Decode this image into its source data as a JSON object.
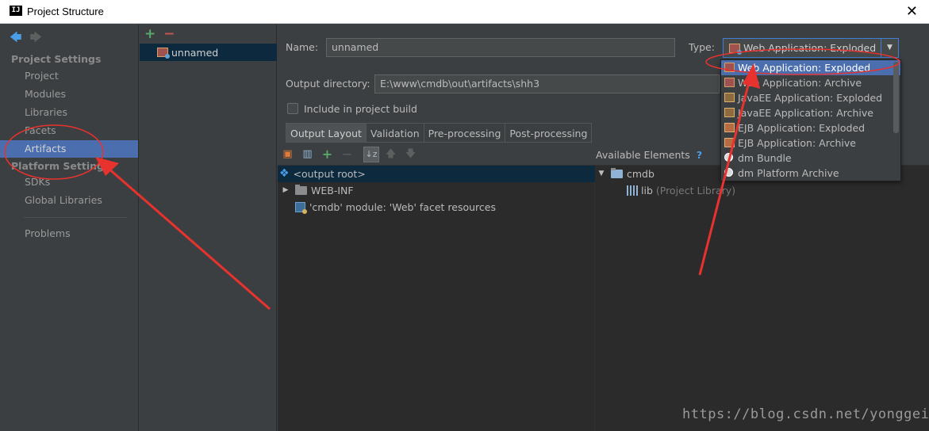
{
  "window": {
    "title": "Project Structure",
    "app_icon_text": "IJ",
    "close_glyph": "✕"
  },
  "nav": {
    "back_glyph": "🡄",
    "forward_glyph": "🡆",
    "project_settings_header": "Project Settings",
    "project_settings_items": [
      "Project",
      "Modules",
      "Libraries",
      "Facets",
      "Artifacts"
    ],
    "platform_settings_header": "Platform Settings",
    "platform_settings_items": [
      "SDKs",
      "Global Libraries"
    ],
    "problems": "Problems",
    "selected": "Artifacts"
  },
  "artifacts": {
    "add_glyph": "+",
    "remove_glyph": "−",
    "items": [
      "unnamed"
    ]
  },
  "main": {
    "name_label": "Name:",
    "name_value": "unnamed",
    "type_label": "Type:",
    "type_value": "Web Application: Exploded",
    "output_dir_label": "Output directory:",
    "output_dir_value": "E:\\www\\cmdb\\out\\artifacts\\shh3",
    "include_in_build_label": "Include in project build",
    "include_in_build_checked": false,
    "tabs": [
      "Output Layout",
      "Validation",
      "Pre-processing",
      "Post-processing"
    ],
    "active_tab": "Output Layout",
    "available_elements_label": "Available Elements",
    "help_glyph": "?",
    "layout_tree": {
      "root": "<output root>",
      "children": [
        "WEB-INF",
        "'cmdb' module: 'Web' facet resources"
      ]
    },
    "available_tree": {
      "root": "cmdb",
      "lib_name": "lib",
      "lib_suffix": "(Project Library)"
    }
  },
  "type_dropdown": {
    "options": [
      {
        "label": "Web Application: Exploded",
        "icon": "war-icon"
      },
      {
        "label": "Web Application: Archive",
        "icon": "war-icon"
      },
      {
        "label": "JavaEE Application: Exploded",
        "icon": "ear-icon"
      },
      {
        "label": "JavaEE Application: Archive",
        "icon": "ear-icon"
      },
      {
        "label": "EJB Application: Exploded",
        "icon": "jar-icon"
      },
      {
        "label": "EJB Application: Archive",
        "icon": "jar-icon"
      },
      {
        "label": "dm Bundle",
        "icon": "bundle-icon"
      },
      {
        "label": "dm Platform Archive",
        "icon": "bundle-icon"
      }
    ],
    "selected_index": 0
  },
  "watermark": "https://blog.csdn.net/yonggeit",
  "colors": {
    "selection_blue": "#4b6eaf",
    "annotation_red": "#e8322e",
    "background": "#3c3f41"
  }
}
